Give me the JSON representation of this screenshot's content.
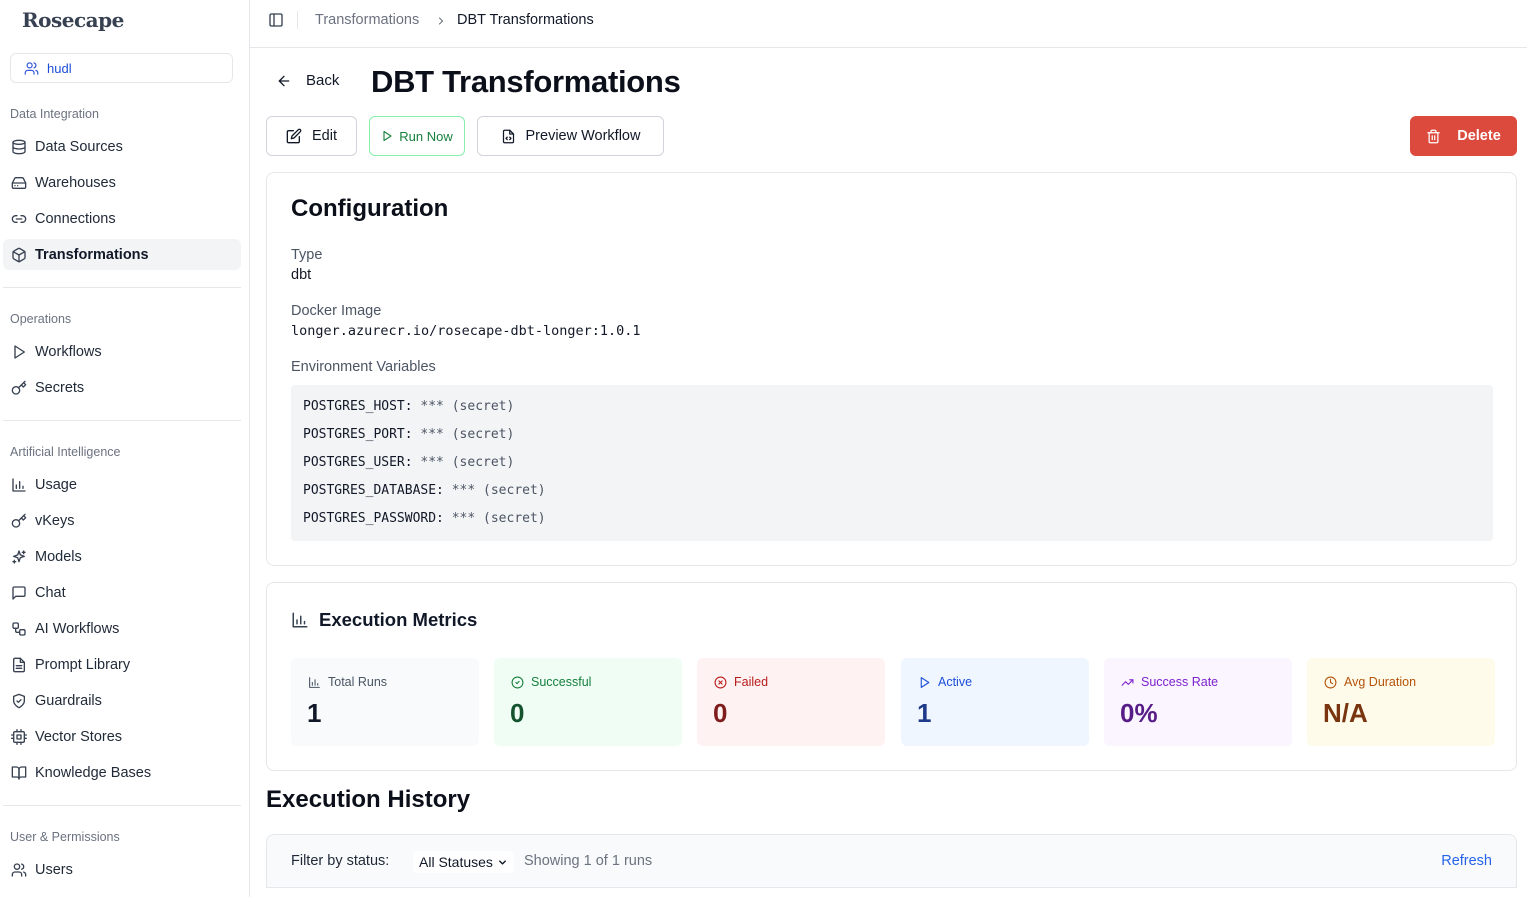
{
  "app": {
    "logo": "Rosecape",
    "org": "hudl"
  },
  "sidebar": {
    "sections": [
      {
        "label": "Data Integration"
      },
      {
        "label": "Operations"
      },
      {
        "label": "Artificial Intelligence"
      },
      {
        "label": "User & Permissions"
      }
    ],
    "items": {
      "data_sources": "Data Sources",
      "warehouses": "Warehouses",
      "connections": "Connections",
      "transformations": "Transformations",
      "workflows": "Workflows",
      "secrets": "Secrets",
      "usage": "Usage",
      "vkeys": "vKeys",
      "models": "Models",
      "chat": "Chat",
      "ai_workflows": "AI Workflows",
      "prompt_library": "Prompt Library",
      "guardrails": "Guardrails",
      "vector_stores": "Vector Stores",
      "knowledge_bases": "Knowledge Bases",
      "users": "Users"
    },
    "active": "transformations"
  },
  "breadcrumb": {
    "parent": "Transformations",
    "current": "DBT Transformations"
  },
  "header": {
    "back": "Back",
    "title": "DBT Transformations",
    "edit": "Edit",
    "run_now": "Run Now",
    "preview": "Preview Workflow",
    "delete": "Delete"
  },
  "config": {
    "title": "Configuration",
    "type_label": "Type",
    "type_value": "dbt",
    "image_label": "Docker Image",
    "image_value": "longer.azurecr.io/rosecape-dbt-longer:1.0.1",
    "env_label": "Environment Variables",
    "env": [
      {
        "key": "POSTGRES_HOST:",
        "value": "*** (secret)"
      },
      {
        "key": "POSTGRES_PORT:",
        "value": "*** (secret)"
      },
      {
        "key": "POSTGRES_USER:",
        "value": "*** (secret)"
      },
      {
        "key": "POSTGRES_DATABASE:",
        "value": "*** (secret)"
      },
      {
        "key": "POSTGRES_PASSWORD:",
        "value": "*** (secret)"
      }
    ]
  },
  "metrics": {
    "title": "Execution Metrics",
    "tiles": [
      {
        "label": "Total Runs",
        "value": "1",
        "bg": "#f8fafc",
        "label_color": "#4b5563",
        "value_color": "#111827",
        "icon": "bar-chart-icon"
      },
      {
        "label": "Successful",
        "value": "0",
        "bg": "#f0fdf4",
        "label_color": "#15803d",
        "value_color": "#14532d",
        "icon": "check-circle-icon"
      },
      {
        "label": "Failed",
        "value": "0",
        "bg": "#fef2f2",
        "label_color": "#b91c1c",
        "value_color": "#7f1d1d",
        "icon": "x-circle-icon"
      },
      {
        "label": "Active",
        "value": "1",
        "bg": "#eff6ff",
        "label_color": "#1d4ed8",
        "value_color": "#1e3a8a",
        "icon": "play-icon"
      },
      {
        "label": "Success Rate",
        "value": "0%",
        "bg": "#faf5ff",
        "label_color": "#7e22ce",
        "value_color": "#581c87",
        "icon": "trending-up-icon"
      },
      {
        "label": "Avg Duration",
        "value": "N/A",
        "bg": "#fffbeb",
        "label_color": "#b45309",
        "value_color": "#78350f",
        "icon": "clock-icon"
      }
    ]
  },
  "history": {
    "title": "Execution History",
    "filter_label": "Filter by status:",
    "filter_value": "All Statuses",
    "count_text": "Showing 1 of 1 runs",
    "refresh": "Refresh"
  }
}
